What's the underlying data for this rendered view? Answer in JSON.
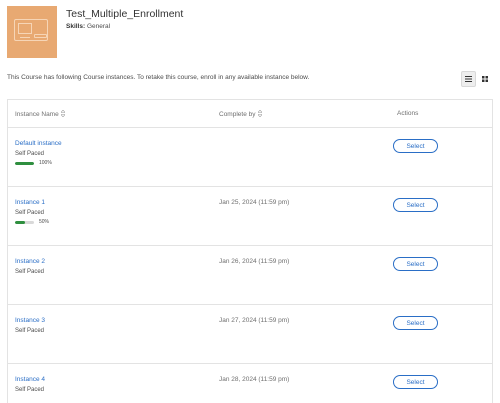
{
  "course": {
    "title": "Test_Multiple_Enrollment",
    "skills_label": "Skills:",
    "skills_value": "General"
  },
  "info_text": "This Course has following Course instances. To retake this course, enroll in any available instance below.",
  "view_toggle": {
    "list_icon": "list-view-icon",
    "grid_icon": "grid-view-icon"
  },
  "table": {
    "headers": {
      "name": "Instance Name",
      "complete_by": "Complete by",
      "actions": "Actions"
    },
    "rows": [
      {
        "name": "Default instance",
        "pace": "Self Paced",
        "progress": 100,
        "progress_label": "100%",
        "complete_by": "",
        "action": "Select"
      },
      {
        "name": "Instance 1",
        "pace": "Self Paced",
        "progress": 50,
        "progress_label": "50%",
        "complete_by": "Jan 25, 2024 (11:59 pm)",
        "action": "Select"
      },
      {
        "name": "Instance 2",
        "pace": "Self Paced",
        "complete_by": "Jan 26, 2024 (11:59 pm)",
        "action": "Select"
      },
      {
        "name": "Instance 3",
        "pace": "Self Paced",
        "complete_by": "Jan 27, 2024 (11:59 pm)",
        "action": "Select"
      },
      {
        "name": "Instance 4",
        "pace": "Self Paced",
        "complete_by": "Jan 28, 2024 (11:59 pm)",
        "action": "Select"
      }
    ]
  },
  "colors": {
    "accent": "#2a6ec6",
    "progress": "#2f8f3f",
    "thumbnail": "#e8a972"
  }
}
